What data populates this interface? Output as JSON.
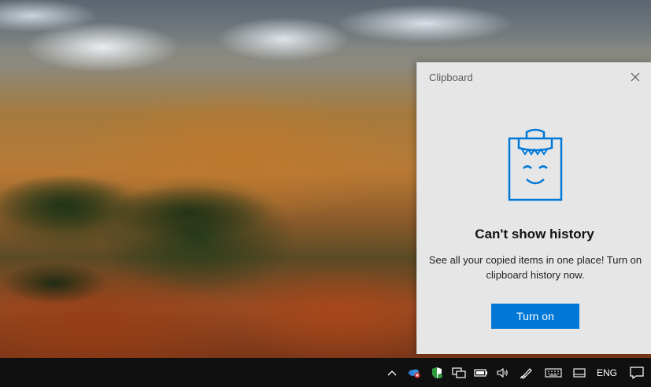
{
  "flyout": {
    "title": "Clipboard",
    "heading": "Can't show history",
    "description": "See all your copied items in one place! Turn on clipboard history now.",
    "button_label": "Turn on",
    "accent_color": "#0078d7",
    "illustration": "clipboard-smiley-icon"
  },
  "taskbar": {
    "tray_icons": [
      "chevron-up-icon",
      "onedrive-icon",
      "defender-shield-icon",
      "network-icon",
      "battery-icon",
      "volume-icon",
      "pen-icon",
      "keyboard-icon",
      "tablet-icon",
      "notification-icon"
    ],
    "language": "ENG"
  }
}
